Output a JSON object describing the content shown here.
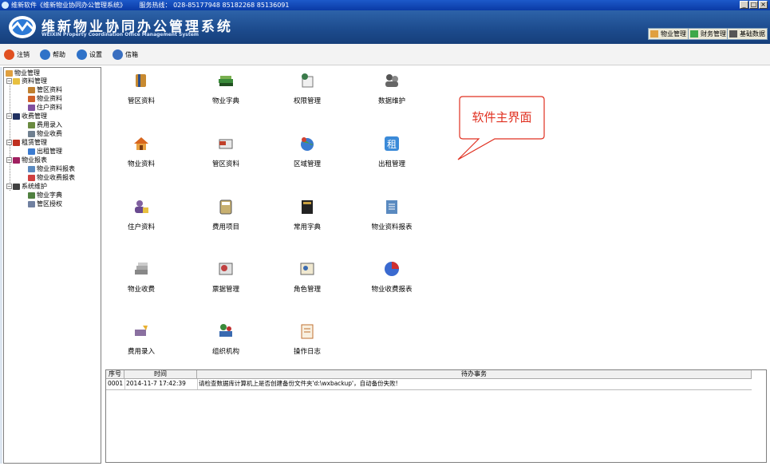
{
  "window": {
    "title": "维新软件《维新物业协同办公管理系统》",
    "hotline": "服务热线： 028-85177948  85182268  85136091"
  },
  "banner": {
    "title_cn": "维新物业协同办公管理系统",
    "title_en": "WEIXIN Property Coordination Office Management System",
    "modules": [
      "物业管理",
      "财务管理",
      "基础数据"
    ]
  },
  "toolbar": [
    "注销",
    "帮助",
    "设置",
    "信箱"
  ],
  "tree": {
    "root": "物业管理",
    "groups": [
      {
        "label": "资料管理",
        "items": [
          "管区资料",
          "物业资料",
          "住户资料"
        ]
      },
      {
        "label": "收费管理",
        "items": [
          "费用录入",
          "物业收费"
        ]
      },
      {
        "label": "租赁管理",
        "items": [
          "出租管理"
        ]
      },
      {
        "label": "物业报表",
        "items": [
          "物业资料报表",
          "物业收费报表"
        ]
      },
      {
        "label": "系统维护",
        "items": [
          "物业字典",
          "管区授权"
        ]
      }
    ]
  },
  "icons": [
    [
      "管区资料",
      "物业字典",
      "权限管理",
      "数据维护"
    ],
    [
      "物业资料",
      "管区资料",
      "区域管理",
      "出租管理"
    ],
    [
      "住户资料",
      "费用项目",
      "常用字典",
      "物业资料报表"
    ],
    [
      "物业收费",
      "票据管理",
      "角色管理",
      "物业收费报表"
    ],
    [
      "费用录入",
      "组织机构",
      "操作日志"
    ]
  ],
  "callout": "软件主界面",
  "todo": {
    "columns": [
      "序号",
      "时间",
      "待办事务"
    ],
    "rows": [
      [
        "0001",
        "2014-11-7 17:42:39",
        "请检查数据库计算机上是否创建备份文件夹'd:\\wxbackup'，自动备份失败!"
      ]
    ]
  }
}
